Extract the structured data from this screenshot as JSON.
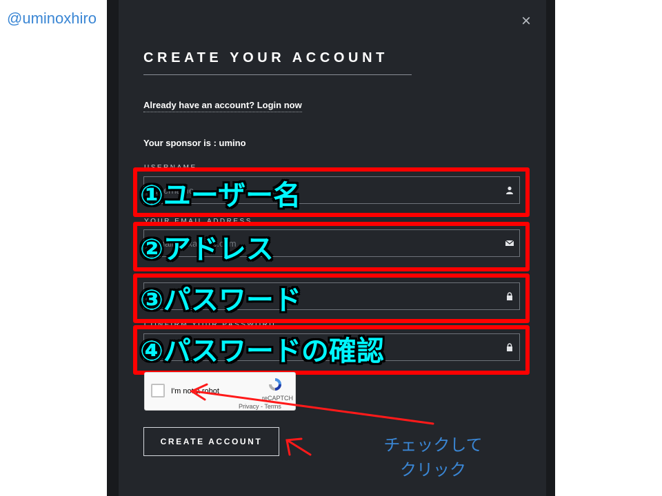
{
  "watermark": "@uminoxhiro",
  "modal": {
    "title": "CREATE YOUR ACCOUNT",
    "login_link": "Already have an account? Login now",
    "sponsor": "Your sponsor is : umino",
    "fields": [
      {
        "label": "USERNAME",
        "placeholder": "Username",
        "icon": "user-icon"
      },
      {
        "label": "YOUR EMAIL ADDRESS",
        "placeholder": "email@example.com",
        "icon": "envelope-icon"
      },
      {
        "label": "",
        "placeholder": "",
        "icon": "lock-icon"
      },
      {
        "label": "CONFIRM YOUR PASSWORD",
        "placeholder": "",
        "icon": "lock-icon"
      }
    ],
    "recaptcha": {
      "label": "I'm not a robot",
      "brand": "reCAPTCH",
      "links": "Privacy - Terms"
    },
    "create_button": "CREATE ACCOUNT"
  },
  "annotations": {
    "items": [
      "①ユーザー名",
      "②アドレス",
      "③パスワード",
      "④パスワードの確認"
    ],
    "note_line1": "チェックして",
    "note_line2": "クリック",
    "highlight_color": "#ff0000",
    "text_color": "#00f6ff",
    "note_color": "#3a86d4"
  }
}
